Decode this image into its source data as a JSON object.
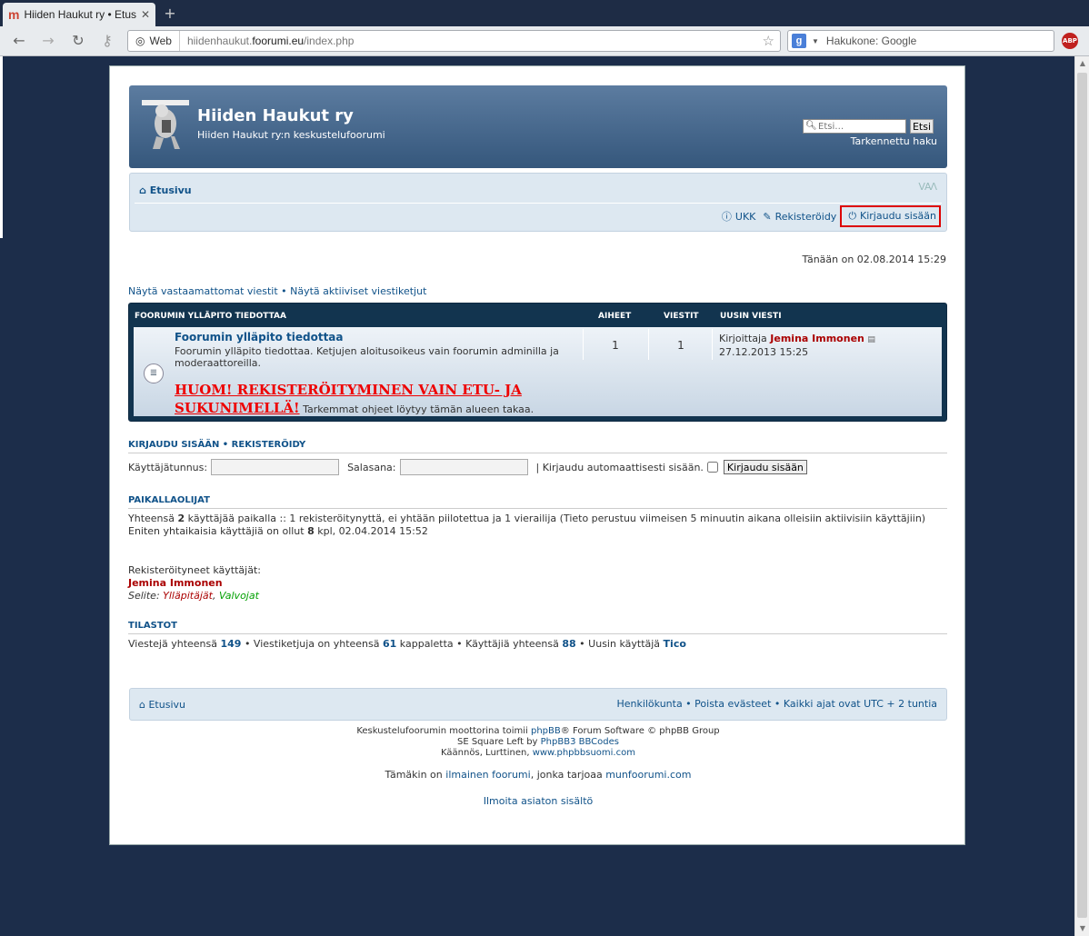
{
  "browser": {
    "tab_title": "Hiiden Haukut ry • Etus...",
    "favicon": "m",
    "web_label": "Web",
    "url_pre": "hiidenhaukut.",
    "url_domain": "foorumi.eu",
    "url_post": "/index.php",
    "search_placeholder": "Hakukone: Google",
    "abp": "ABP"
  },
  "header": {
    "site_name": "Hiiden Haukut ry",
    "site_desc": "Hiiden Haukut ry:n keskustelufoorumi",
    "search_placeholder": "Etsi…",
    "search_button": "Etsi",
    "advanced_search": "Tarkennettu haku"
  },
  "navbar": {
    "home": "Etusivu",
    "font_size": "ᐯAᐱ",
    "faq": "UKK",
    "register": "Rekisteröidy",
    "login": "Kirjaudu sisään"
  },
  "date_text": "Tänään on 02.08.2014 15:29",
  "quick_links": "Näytä vastaamattomat viestit • Näytä aktiiviset viestiketjut",
  "forum": {
    "header_title": "FOORUMIN YLLÄPITO TIEDOTTAA",
    "header_topics": "AIHEET",
    "header_posts": "VIESTIT",
    "header_last": "UUSIN VIESTI",
    "title": "Foorumin ylläpito tiedottaa",
    "desc": "Foorumin ylläpito tiedottaa. Ketjujen aloitusoikeus vain foorumin adminilla ja moderaattoreilla.",
    "warning": "HUOM! REKISTERÖITYMINEN VAIN ETU- JA SUKUNIMELLÄ!",
    "warning_more": " Tarkemmat ohjeet löytyy tämän alueen takaa.",
    "topics": "1",
    "posts": "1",
    "last_by": "Kirjoittaja ",
    "last_user": "Jemina Immonen",
    "last_date": "27.12.2013 15:25"
  },
  "login_section": {
    "title": "KIRJAUDU SISÄÄN  •  REKISTERÖIDY",
    "username_label": "Käyttäjätunnus:",
    "password_label": "Salasana:",
    "auto_label": "| Kirjaudu automaattisesti sisään.",
    "login_button": "Kirjaudu sisään"
  },
  "online": {
    "title": "PAIKALLAOLIJAT",
    "line1_a": "Yhteensä ",
    "line1_num": "2",
    "line1_b": " käyttäjää paikalla :: 1 rekisteröitynyttä, ei yhtään piilotettua ja 1 vierailija (Tieto perustuu viimeisen 5 minuutin aikana olleisiin aktiivisiin käyttäjiin)",
    "line2_a": "Eniten yhtaikaisia käyttäjiä on ollut ",
    "line2_num": "8",
    "line2_b": " kpl, 02.04.2014 15:52",
    "registered_label": "Rekisteröityneet käyttäjät:",
    "registered_user": "Jemina Immonen",
    "legend_label": "Selite: ",
    "legend_admin": "Ylläpitäjät",
    "legend_sep": ", ",
    "legend_mod": "Valvojat"
  },
  "stats": {
    "title": "TILASTOT",
    "a": "Viestejä yhteensä ",
    "posts": "149",
    "b": " • Viestiketjuja on yhteensä ",
    "topics": "61",
    "c": " kappaletta • Käyttäjiä yhteensä ",
    "users": "88",
    "d": " • Uusin käyttäjä ",
    "newest": "Tico"
  },
  "footer": {
    "home": "Etusivu",
    "right": "Henkilökunta • Poista evästeet • Kaikki ajat ovat UTC + 2 tuntia",
    "copy1_a": "Keskustelufoorumin moottorina toimii ",
    "copy1_link": "phpBB",
    "copy1_b": "® Forum Software © phpBB Group",
    "copy2_a": "SE Square Left by ",
    "copy2_link": "PhpBB3 BBCodes",
    "copy3_a": "Käännös, Lurttinen, ",
    "copy3_link": "www.phpbbsuomi.com",
    "free_a": "Tämäkin on ",
    "free_link1": "ilmainen foorumi",
    "free_b": ", jonka tarjoaa ",
    "free_link2": "munfoorumi.com",
    "report": "Ilmoita asiaton sisältö"
  }
}
